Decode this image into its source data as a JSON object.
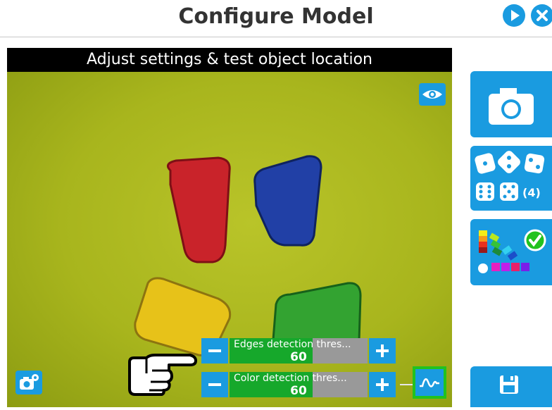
{
  "header": {
    "title": "Configure Model",
    "next_icon": "play-icon",
    "close_icon": "close-icon"
  },
  "viewer": {
    "banner": "Adjust settings & test object location",
    "eye_icon": "eye-icon",
    "camera_settings_icon": "camera-settings-icon",
    "pointer_icon": "pointing-hand-icon",
    "objects": [
      {
        "color": "#c9232a",
        "name": "red-block"
      },
      {
        "color": "#2140a6",
        "name": "blue-block"
      },
      {
        "color": "#e7c219",
        "name": "yellow-block"
      },
      {
        "color": "#33a331",
        "name": "green-block"
      }
    ]
  },
  "sliders": [
    {
      "label": "Edges detection thres...",
      "value": "60",
      "fill_percent": 60
    },
    {
      "label": "Color detection thres...",
      "value": "60",
      "fill_percent": 60
    }
  ],
  "waveform_button_icon": "signal-waveform-icon",
  "side_panel": {
    "camera_icon": "camera-icon",
    "dice_count": "(4)",
    "dice_icon": "dice-icon",
    "color_icon": "color-palette-check-icon",
    "save_icon": "floppy-disk-icon"
  },
  "colors": {
    "accent": "#1a9be0",
    "fill_green": "#16a82b",
    "highlight_green": "#22c21e"
  }
}
